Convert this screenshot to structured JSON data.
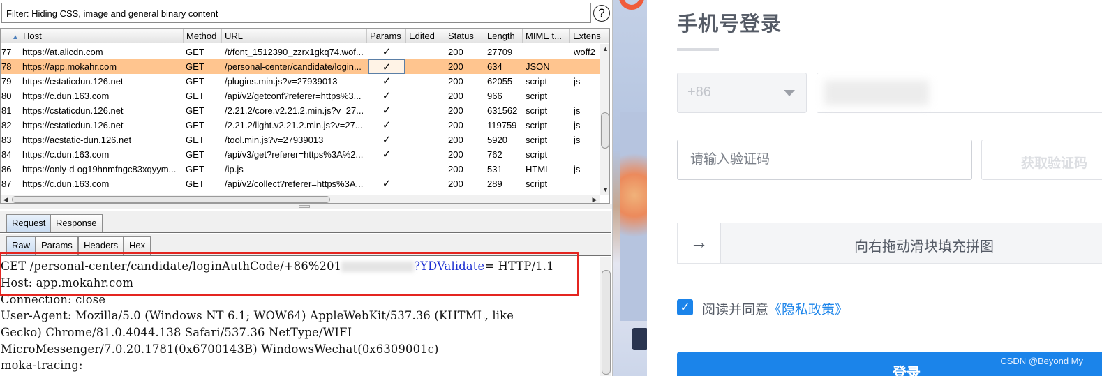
{
  "burp": {
    "filter_text": "Filter: Hiding CSS, image and general binary content",
    "help_icon": "?",
    "columns": [
      "",
      "Host",
      "Method",
      "URL",
      "Params",
      "Edited",
      "Status",
      "Length",
      "MIME t...",
      "Extens"
    ],
    "rows": [
      {
        "num": "77",
        "host": "https://at.alicdn.com",
        "method": "GET",
        "url": "/t/font_1512390_zzrx1gkq74.wof...",
        "params": "✓",
        "status": "200",
        "length": "27709",
        "mime": "",
        "ext": "woff2"
      },
      {
        "num": "78",
        "host": "https://app.mokahr.com",
        "method": "GET",
        "url": "/personal-center/candidate/login...",
        "params": "✓",
        "status": "200",
        "length": "634",
        "mime": "JSON",
        "ext": "",
        "selected": true
      },
      {
        "num": "79",
        "host": "https://cstaticdun.126.net",
        "method": "GET",
        "url": "/plugins.min.js?v=27939013",
        "params": "✓",
        "status": "200",
        "length": "62055",
        "mime": "script",
        "ext": "js"
      },
      {
        "num": "80",
        "host": "https://c.dun.163.com",
        "method": "GET",
        "url": "/api/v2/getconf?referer=https%3...",
        "params": "✓",
        "status": "200",
        "length": "966",
        "mime": "script",
        "ext": ""
      },
      {
        "num": "81",
        "host": "https://cstaticdun.126.net",
        "method": "GET",
        "url": "/2.21.2/core.v2.21.2.min.js?v=27...",
        "params": "✓",
        "status": "200",
        "length": "631562",
        "mime": "script",
        "ext": "js"
      },
      {
        "num": "82",
        "host": "https://cstaticdun.126.net",
        "method": "GET",
        "url": "/2.21.2/light.v2.21.2.min.js?v=27...",
        "params": "✓",
        "status": "200",
        "length": "119759",
        "mime": "script",
        "ext": "js"
      },
      {
        "num": "83",
        "host": "https://acstatic-dun.126.net",
        "method": "GET",
        "url": "/tool.min.js?v=27939013",
        "params": "✓",
        "status": "200",
        "length": "5920",
        "mime": "script",
        "ext": "js"
      },
      {
        "num": "84",
        "host": "https://c.dun.163.com",
        "method": "GET",
        "url": "/api/v3/get?referer=https%3A%2...",
        "params": "✓",
        "status": "200",
        "length": "762",
        "mime": "script",
        "ext": ""
      },
      {
        "num": "86",
        "host": "https://only-d-og19hnmfngc83xqyym...",
        "method": "GET",
        "url": "/ip.js",
        "params": "",
        "status": "200",
        "length": "531",
        "mime": "HTML",
        "ext": "js"
      },
      {
        "num": "87",
        "host": "https://c.dun.163.com",
        "method": "GET",
        "url": "/api/v2/collect?referer=https%3A...",
        "params": "✓",
        "status": "200",
        "length": "289",
        "mime": "script",
        "ext": ""
      }
    ],
    "msg_tabs": [
      "Request",
      "Response"
    ],
    "view_tabs": [
      "Raw",
      "Params",
      "Headers",
      "Hex"
    ],
    "raw": {
      "line1_before": "GET /personal-center/candidate/loginAuthCode/+86%201",
      "line1_param": "?YDValidate",
      "line1_after": "= HTTP/1.1",
      "lines": [
        "Host: app.mokahr.com",
        "Connection: close",
        "User-Agent: Mozilla/5.0 (Windows NT 6.1; WOW64) AppleWebKit/537.36 (KHTML, like",
        "Gecko) Chrome/81.0.4044.138 Safari/537.36 NetType/WIFI",
        "MicroMessenger/7.0.20.1781(0x6700143B) WindowsWechat(0x6309001c)",
        "moka-tracing:"
      ]
    },
    "highlight_color": "#ffc58f",
    "annotation_color": "#e42520"
  },
  "login": {
    "title": "手机号登录",
    "country_code": "+86",
    "code_placeholder": "请输入验证码",
    "get_code": "获取验证码",
    "slider_arrow": "→",
    "slider_text": "向右拖动滑块填充拼图",
    "agree_text": "阅读并同意",
    "agree_link": "《隐私政策》",
    "checkbox_mark": "✓",
    "login_button": "登录",
    "watermark": "CSDN @Beyond My",
    "accent_color": "#1b84ea"
  }
}
